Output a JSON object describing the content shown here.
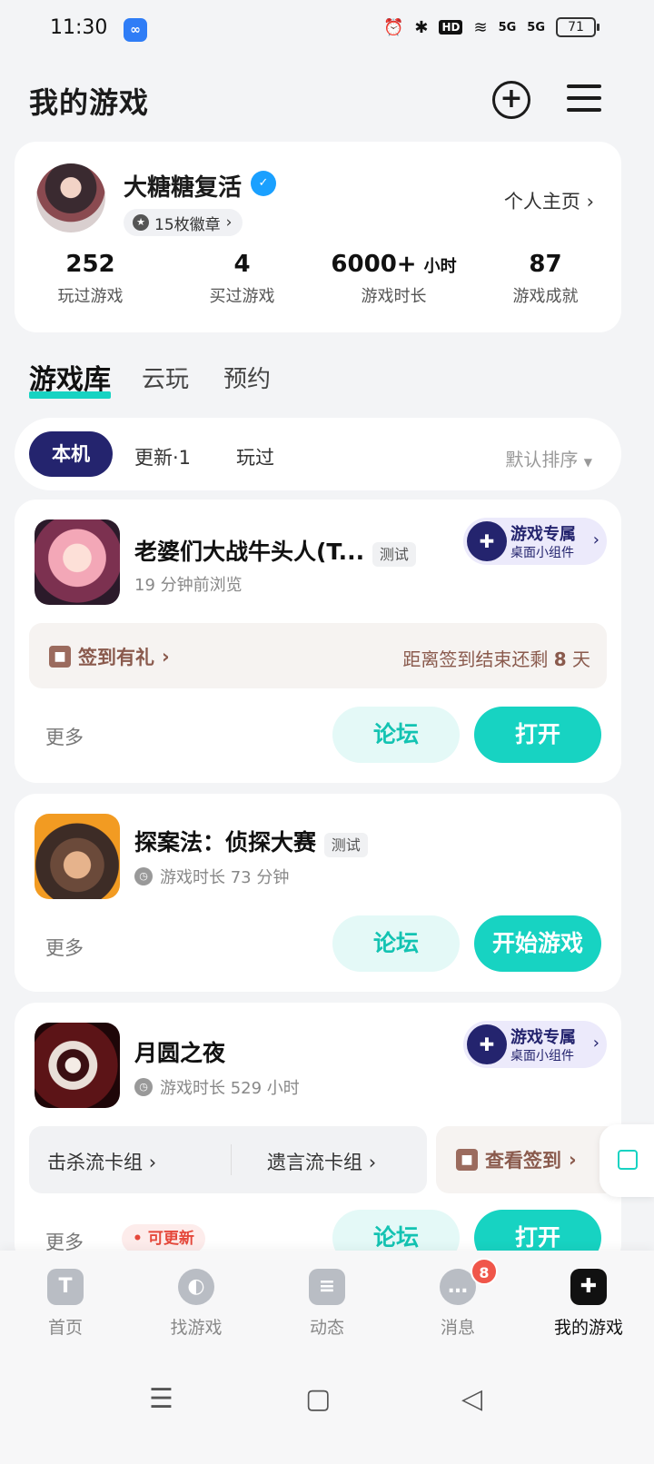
{
  "status_bar": {
    "time": "11:30",
    "hd_label": "HD",
    "net1": "5G",
    "net2": "5G",
    "battery": "71"
  },
  "header": {
    "title": "我的游戏"
  },
  "profile": {
    "name": "大糖糖复活",
    "badges": "15枚徽章",
    "home_link": "个人主页",
    "stats": [
      {
        "value": "252",
        "unit": "",
        "label": "玩过游戏"
      },
      {
        "value": "4",
        "unit": "",
        "label": "买过游戏"
      },
      {
        "value": "6000+",
        "unit": "小时",
        "label": "游戏时长"
      },
      {
        "value": "87",
        "unit": "",
        "label": "游戏成就"
      }
    ]
  },
  "main_tabs": [
    "游戏库",
    "云玩",
    "预约"
  ],
  "filter": {
    "chips": [
      "本机",
      "更新·1",
      "玩过"
    ],
    "sort": "默认排序"
  },
  "widget": {
    "title": "游戏专属",
    "subtitle": "桌面小组件"
  },
  "games": [
    {
      "title": "老婆们大战牛头人(T...",
      "tag": "测试",
      "sub": "19 分钟前浏览",
      "checkin_label": "签到有礼",
      "checkin_remain_prefix": "距离签到结束还剩",
      "checkin_days": "8",
      "checkin_remain_suffix": "天",
      "more": "更多",
      "forum": "论坛",
      "action": "打开"
    },
    {
      "title": "探案法：侦探大赛",
      "tag": "测试",
      "sub": "游戏时长 73 分钟",
      "more": "更多",
      "forum": "论坛",
      "action": "开始游戏"
    },
    {
      "title": "月圆之夜",
      "sub": "游戏时长 529 小时",
      "deck1": "击杀流卡组",
      "deck2": "遗言流卡组",
      "checkin_view": "查看签到",
      "more": "更多",
      "update": "可更新",
      "forum": "论坛",
      "action": "打开"
    }
  ],
  "bottom_nav": [
    {
      "label": "首页",
      "icon": "home-icon"
    },
    {
      "label": "找游戏",
      "icon": "planet-icon"
    },
    {
      "label": "动态",
      "icon": "feed-icon"
    },
    {
      "label": "消息",
      "icon": "message-icon",
      "badge": "8"
    },
    {
      "label": "我的游戏",
      "icon": "gamepad-icon"
    }
  ],
  "colors": {
    "accent": "#17d3c2",
    "navy": "#24246e",
    "checkin_text": "#8a5a4d"
  }
}
